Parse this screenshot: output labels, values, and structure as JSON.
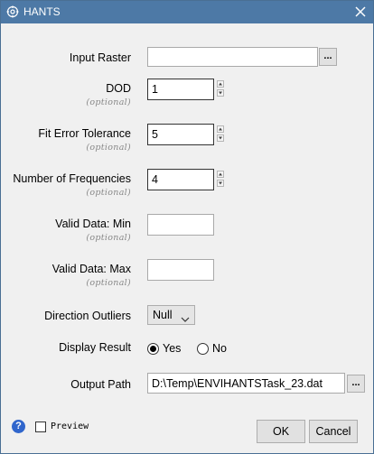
{
  "window": {
    "title": "HANTS"
  },
  "fields": {
    "input_raster": {
      "label": "Input Raster",
      "value": "",
      "browse_label": "..."
    },
    "dod": {
      "label": "DOD",
      "optional": "(optional)",
      "value": "1"
    },
    "fit_error_tolerance": {
      "label": "Fit Error Tolerance",
      "optional": "(optional)",
      "value": "5"
    },
    "number_of_frequencies": {
      "label": "Number of Frequencies",
      "optional": "(optional)",
      "value": "4"
    },
    "valid_data_min": {
      "label": "Valid Data: Min",
      "optional": "(optional)",
      "value": ""
    },
    "valid_data_max": {
      "label": "Valid Data: Max",
      "optional": "(optional)",
      "value": ""
    },
    "direction_outliers": {
      "label": "Direction Outliers",
      "value": "Null"
    },
    "display_result": {
      "label": "Display Result",
      "options": [
        "Yes",
        "No"
      ],
      "selected": "Yes"
    },
    "output_path": {
      "label": "Output Path",
      "value": "D:\\Temp\\ENVIHANTSTask_23.dat",
      "browse_label": "..."
    }
  },
  "footer": {
    "help_icon": "?",
    "preview_label": "Preview",
    "preview_checked": false,
    "ok_label": "OK",
    "cancel_label": "Cancel"
  },
  "icons": {
    "app": "hants-app-icon",
    "close": "close-icon",
    "spin_up": "spin-up-icon",
    "spin_down": "spin-down-icon",
    "dropdown": "chevron-down-icon",
    "help": "help-icon"
  },
  "colors": {
    "titlebar": "#4d79a6",
    "background": "#f0f0f0",
    "help": "#3066cc"
  }
}
